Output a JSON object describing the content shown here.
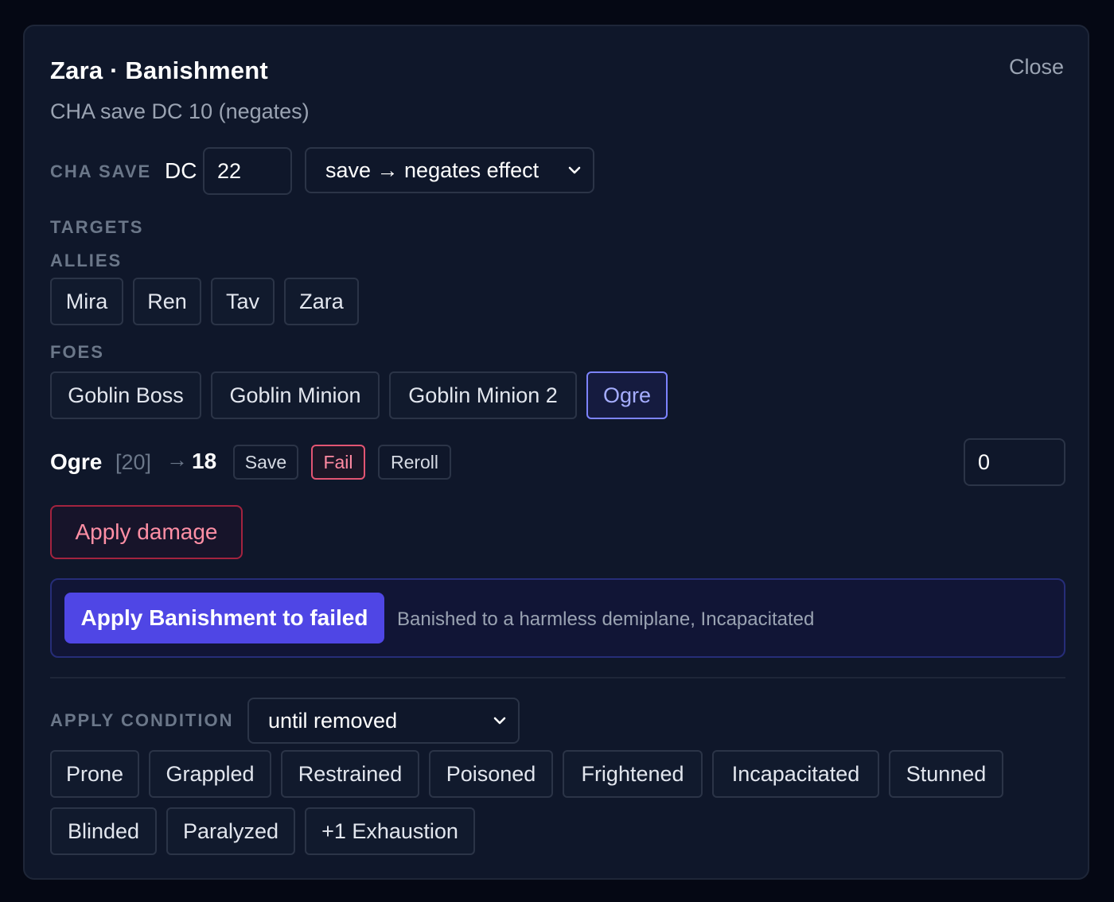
{
  "header": {
    "title": "Zara · Banishment",
    "close_label": "Close",
    "subtitle": "CHA save DC 10 (negates)"
  },
  "save": {
    "ability_label": "CHA SAVE",
    "dc_label": "DC",
    "dc_value": "22",
    "mode": "save → negates effect"
  },
  "targets": {
    "heading": "TARGETS",
    "allies_label": "ALLIES",
    "allies": [
      "Mira",
      "Ren",
      "Tav",
      "Zara"
    ],
    "foes_label": "FOES",
    "foes": [
      "Goblin Boss",
      "Goblin Minion",
      "Goblin Minion 2",
      "Ogre"
    ],
    "selected_foe": "Ogre"
  },
  "roll": {
    "target": "Ogre",
    "raw": "[20]",
    "arrow": "→",
    "total": "18",
    "save_label": "Save",
    "fail_label": "Fail",
    "reroll_label": "Reroll",
    "damage_value": "0",
    "result": "Fail"
  },
  "actions": {
    "apply_damage_label": "Apply damage",
    "apply_effect_label": "Apply Banishment to failed",
    "effect_description": "Banished to a harmless demiplane, Incapacitated"
  },
  "condition": {
    "label": "APPLY CONDITION",
    "duration": "until removed",
    "conditions": [
      "Prone",
      "Grappled",
      "Restrained",
      "Poisoned",
      "Frightened",
      "Incapacitated",
      "Stunned",
      "Blinded",
      "Paralyzed",
      "+1 Exhaustion"
    ]
  },
  "colors": {
    "background": "#050814",
    "panel": "#0f172a",
    "accent": "#4f46e5",
    "selected": "#7c83ff",
    "danger": "#e25573"
  }
}
